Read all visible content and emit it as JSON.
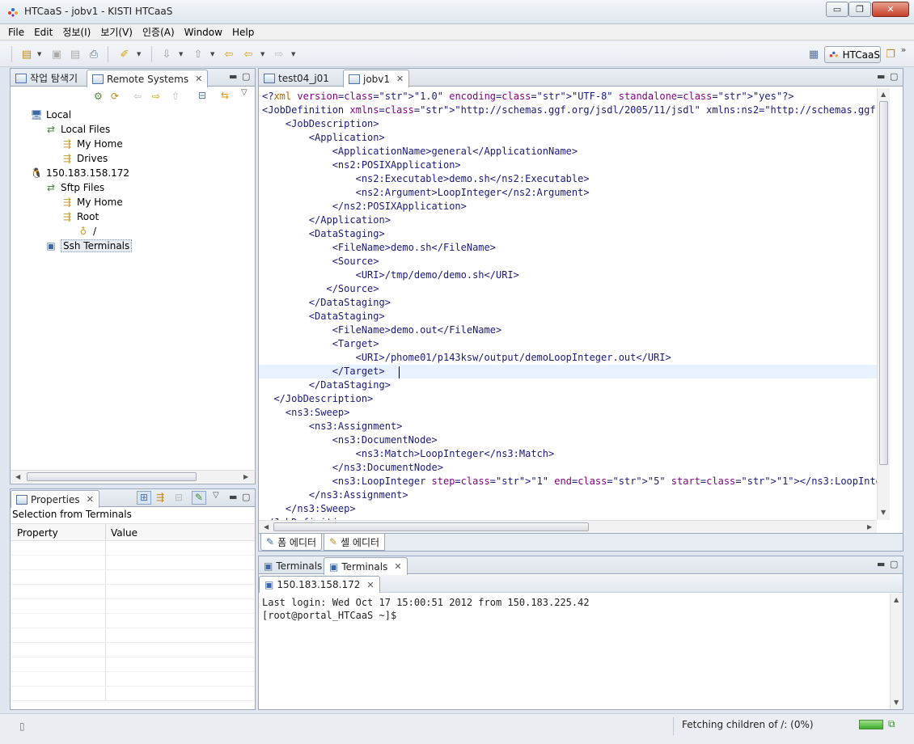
{
  "window": {
    "title": "HTCaaS - jobv1 - KISTI HTCaaS",
    "min_label": "▭",
    "restore_label": "❐",
    "close_label": "✕"
  },
  "menubar": {
    "items": [
      "File",
      "Edit",
      "정보(I)",
      "보기(V)",
      "인증(A)",
      "Window",
      "Help"
    ]
  },
  "toolbar": {
    "perspective_label": "HTCaaS"
  },
  "left_panel": {
    "tabs": [
      {
        "label": "작업 탐색기"
      },
      {
        "label": "Remote Systems"
      }
    ],
    "tree": [
      {
        "label": "Local",
        "icon": "computer-icon"
      },
      {
        "label": "Local Files",
        "icon": "file-subsystem-icon"
      },
      {
        "label": "My Home",
        "icon": "filter-icon"
      },
      {
        "label": "Drives",
        "icon": "filter-icon"
      },
      {
        "label": "150.183.158.172",
        "icon": "linux-host-icon"
      },
      {
        "label": "Sftp Files",
        "icon": "file-subsystem-icon"
      },
      {
        "label": "My Home",
        "icon": "filter-icon"
      },
      {
        "label": "Root",
        "icon": "filter-icon"
      },
      {
        "label": "/",
        "icon": "root-folder-icon"
      },
      {
        "label": "Ssh Terminals",
        "icon": "terminal-subsystem-icon"
      }
    ]
  },
  "properties_panel": {
    "tab_label": "Properties",
    "selection_label": "Selection from Terminals",
    "columns": [
      "Property",
      "Value"
    ]
  },
  "editor": {
    "tabs": [
      {
        "label": "test04_j01"
      },
      {
        "label": "jobv1"
      }
    ],
    "bottom_tabs": [
      {
        "label": "폼 에디터"
      },
      {
        "label": "셸 에디터"
      }
    ]
  },
  "terminals_panel": {
    "tabs": [
      {
        "label": "Terminals"
      },
      {
        "label": "Terminals"
      }
    ],
    "session_tab": "150.183.158.172",
    "lines": [
      "Last login: Wed Oct 17 15:00:51 2012 from 150.183.225.42",
      "[root@portal_HTCaaS ~]$"
    ]
  },
  "status": {
    "text": "Fetching children of /: (0%)"
  },
  "colors": {
    "tag": "#2e2e8f",
    "attr": "#7f007f",
    "string": "#2a00ff",
    "cursor_line": "#e8f2fe",
    "panel_border": "#99a8bd"
  }
}
